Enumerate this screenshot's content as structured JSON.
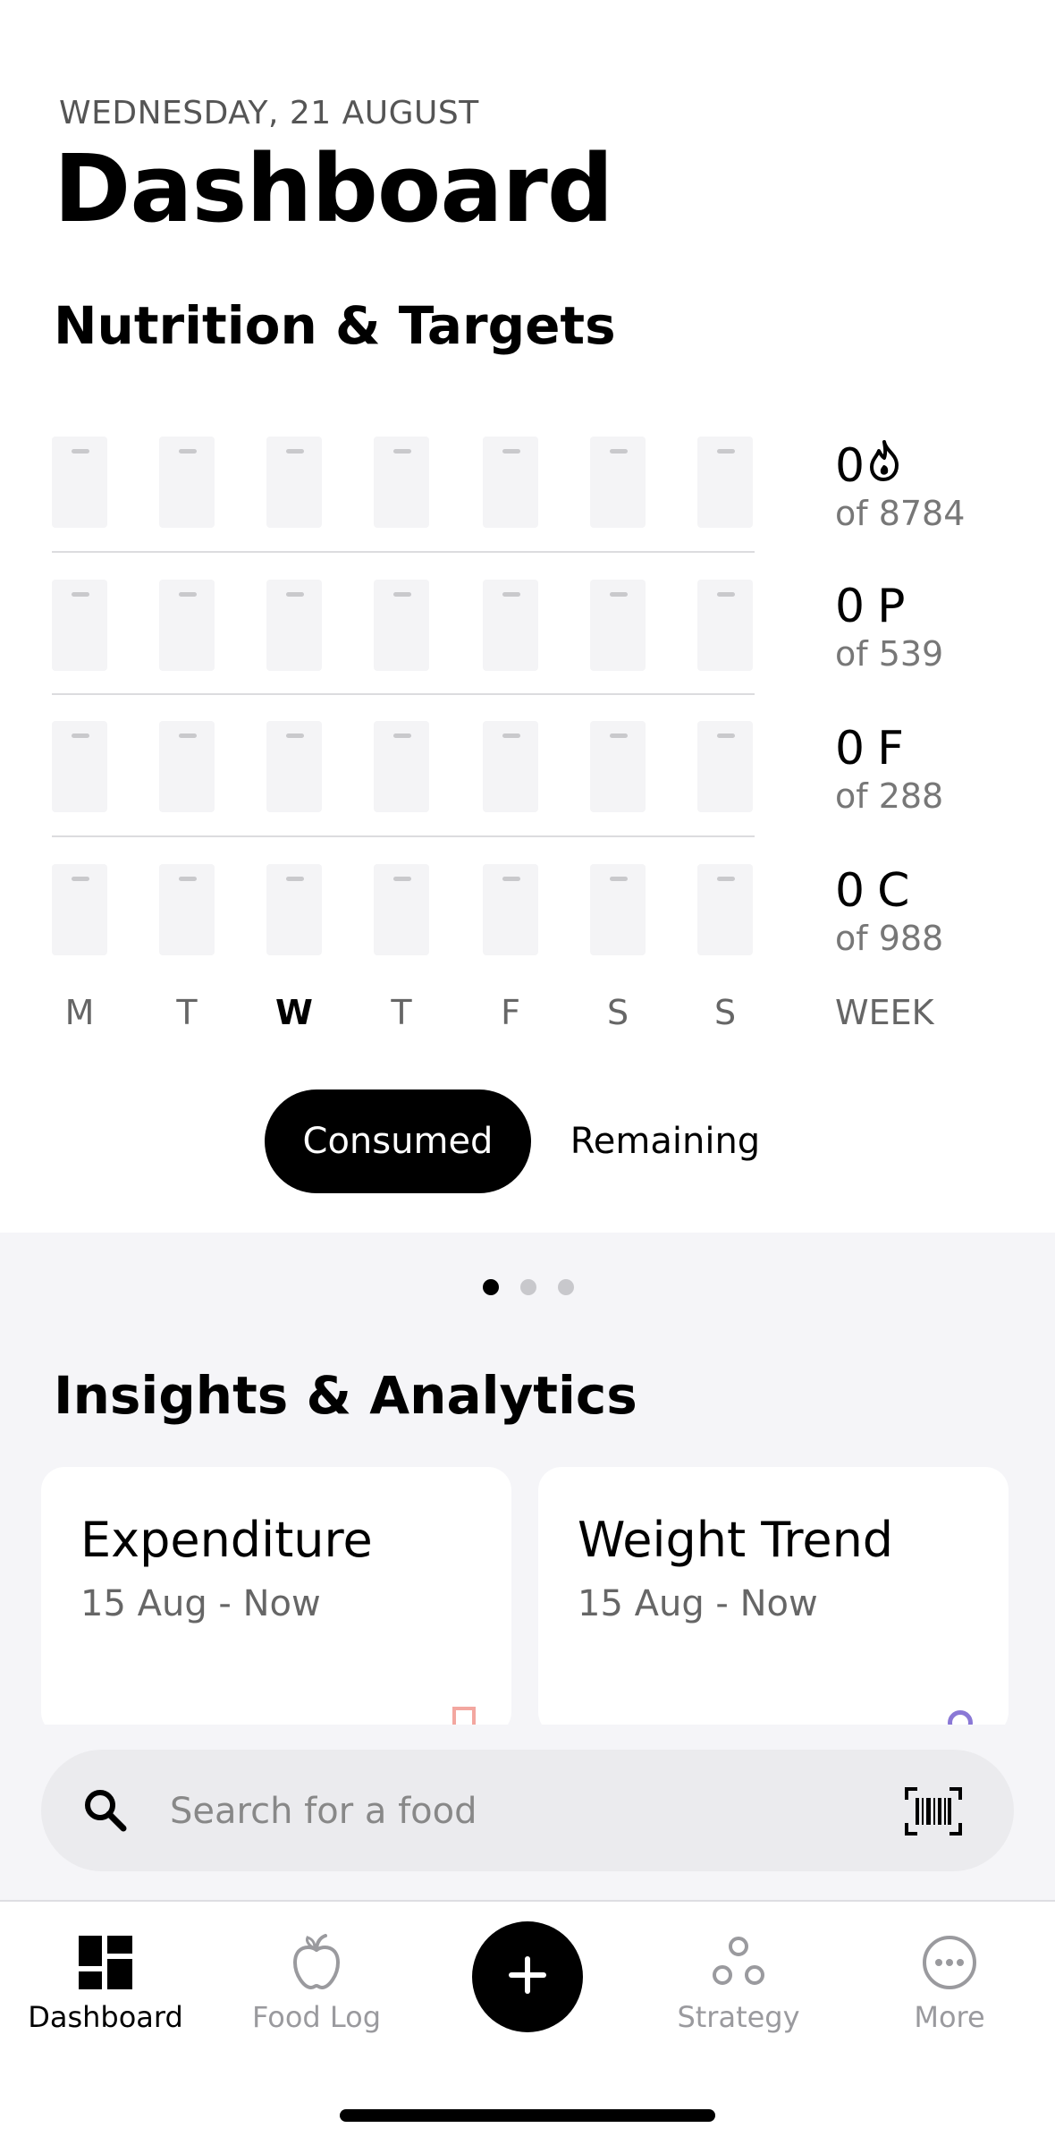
{
  "header": {
    "date": "WEDNESDAY, 21 AUGUST",
    "title": "Dashboard"
  },
  "nutrition": {
    "title": "Nutrition & Targets",
    "metrics": [
      {
        "value": "0",
        "icon": "flame-icon",
        "unit": "",
        "target": "of 8784"
      },
      {
        "value": "0",
        "unit": "P",
        "target": "of 539"
      },
      {
        "value": "0",
        "unit": "F",
        "target": "of 288"
      },
      {
        "value": "0",
        "unit": "C",
        "target": "of 988"
      }
    ],
    "days": [
      "M",
      "T",
      "W",
      "T",
      "F",
      "S",
      "S"
    ],
    "active_day_index": 2,
    "week_label": "WEEK",
    "toggle": {
      "consumed": "Consumed",
      "remaining": "Remaining",
      "selected": "consumed"
    }
  },
  "pager": {
    "count": 3,
    "active": 0
  },
  "insights": {
    "title": "Insights & Analytics",
    "cards": [
      {
        "title": "Expenditure",
        "subtitle": "15 Aug - Now",
        "accent": "#f3a7a0"
      },
      {
        "title": "Weight Trend",
        "subtitle": "15 Aug - Now",
        "accent": "#8a78d6"
      }
    ]
  },
  "search": {
    "placeholder": "Search for a food",
    "value": ""
  },
  "nav": {
    "items": [
      {
        "label": "Dashboard",
        "icon": "dashboard-icon",
        "active": true
      },
      {
        "label": "Food Log",
        "icon": "apple-icon",
        "active": false
      },
      {
        "label": "",
        "icon": "plus-icon",
        "active": false
      },
      {
        "label": "Strategy",
        "icon": "strategy-icon",
        "active": false
      },
      {
        "label": "More",
        "icon": "more-icon",
        "active": false
      }
    ]
  }
}
